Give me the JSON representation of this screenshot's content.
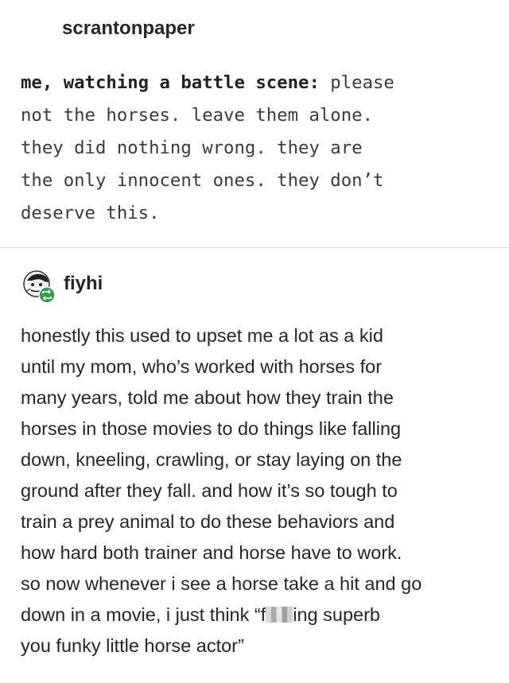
{
  "post": {
    "username": "scrantonpaper",
    "bold_text": "me, watching a battle scene:",
    "lines": [
      " please",
      "not the horses. leave them alone.",
      "they did nothing wrong. they are",
      "the only innocent ones. they don’t",
      "deserve this."
    ]
  },
  "reply": {
    "username": "fiyhi",
    "icon": "reblog-icon",
    "lines": [
      "honestly this used to upset me a lot as a kid",
      "until my mom, who’s worked with horses for",
      "many years, told me about how they train the",
      "horses in those movies to do things like falling",
      "down, kneeling, crawling, or stay laying on the",
      "ground after they fall. and how it’s so tough to",
      "train a prey animal to do these behaviors and",
      "how hard both trainer and horse have to work.",
      "so now whenever i see a horse take a hit and go"
    ],
    "censored_line_before": "down in a movie, i just think “f",
    "censored_line_after": "ing superb",
    "last_line": "you funky little horse actor”"
  },
  "colors": {
    "reblog_badge": "#2e9e4f",
    "divider": "#d9d9d9"
  }
}
